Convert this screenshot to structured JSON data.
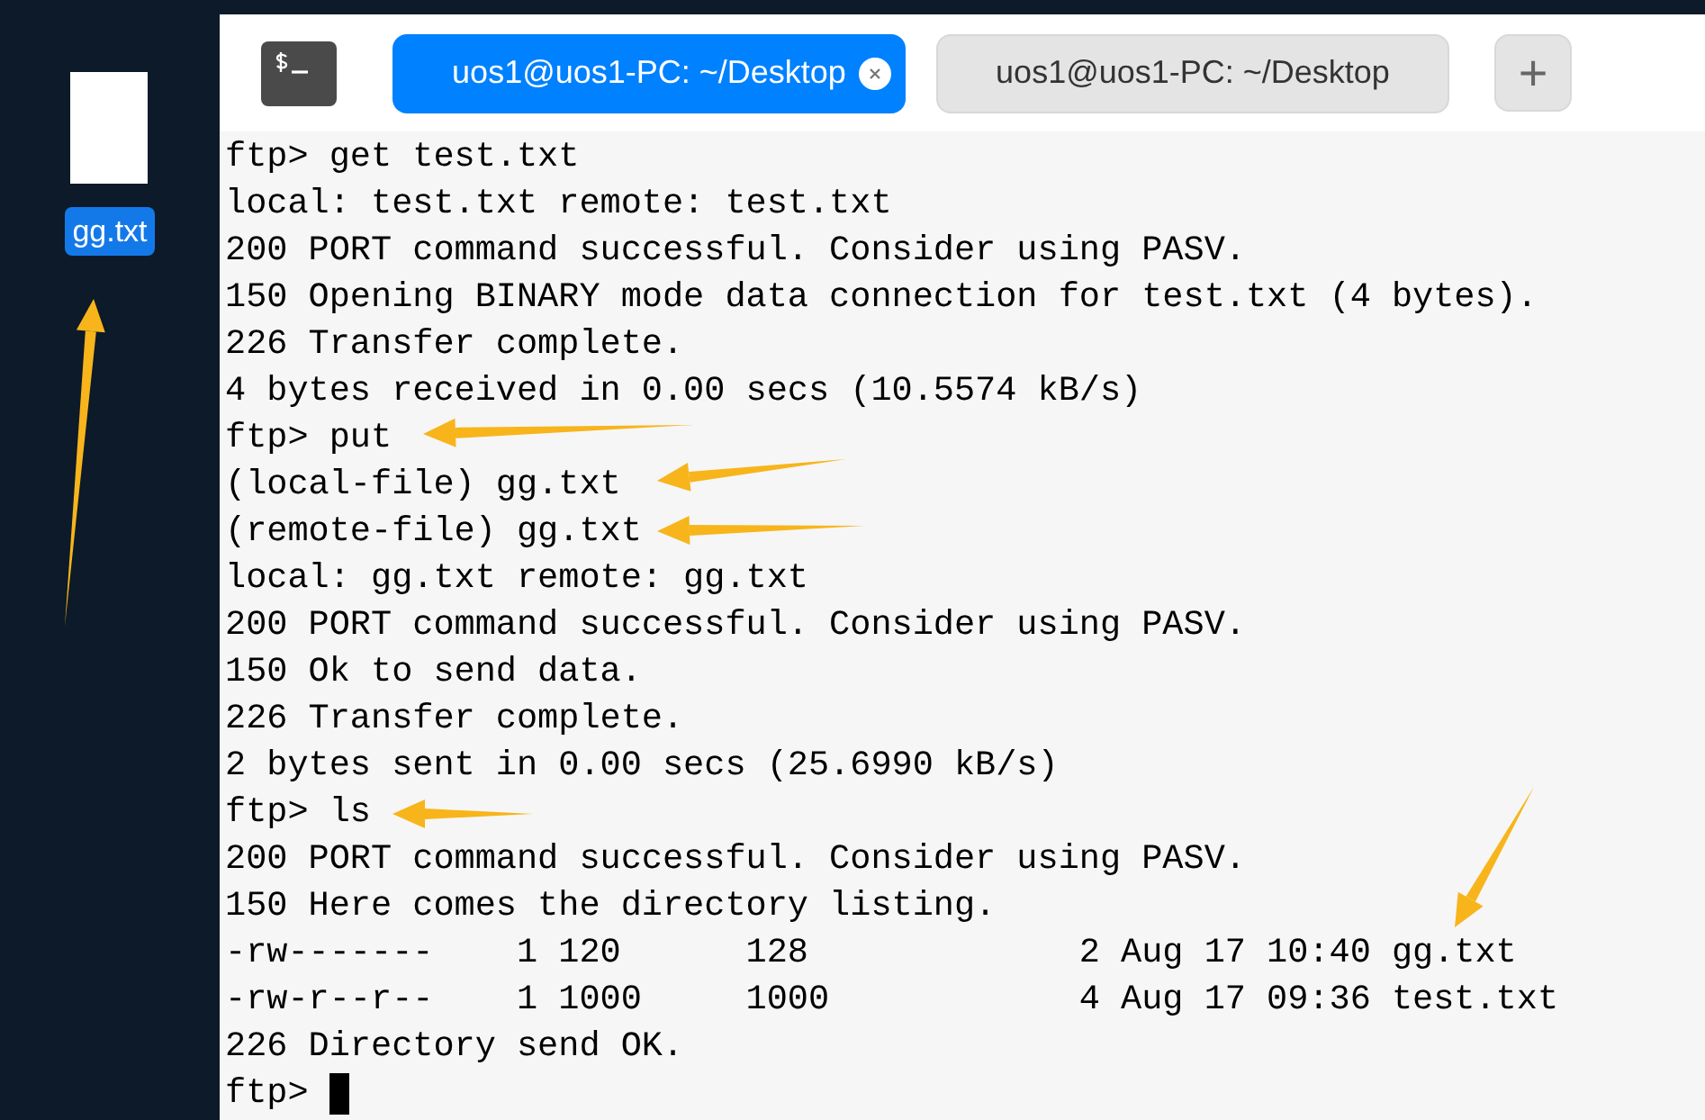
{
  "desktop": {
    "file": {
      "label": "gg.txt",
      "selected": true
    }
  },
  "terminal": {
    "tabs": [
      {
        "label": "uos1@uos1-PC: ~/Desktop",
        "selected": true
      },
      {
        "label": "uos1@uos1-PC: ~/Desktop",
        "selected": false
      }
    ],
    "new_tab": "+",
    "lines": [
      {
        "text": "ftp> get test.txt"
      },
      {
        "text": "local: test.txt remote: test.txt"
      },
      {
        "text": "200 PORT command successful. Consider using PASV."
      },
      {
        "text": "150 Opening BINARY mode data connection for test.txt (4 bytes)."
      },
      {
        "text": "226 Transfer complete."
      },
      {
        "text": "4 bytes received in 0.00 secs (10.5574 kB/s)"
      },
      {
        "text": "ftp> put"
      },
      {
        "text": "(local-file) gg.txt"
      },
      {
        "text": "(remote-file) gg.txt"
      },
      {
        "text": "local: gg.txt remote: gg.txt"
      },
      {
        "text": "200 PORT command successful. Consider using PASV."
      },
      {
        "text": "150 Ok to send data."
      },
      {
        "text": "226 Transfer complete."
      },
      {
        "text": "2 bytes sent in 0.00 secs (25.6990 kB/s)"
      },
      {
        "text": "ftp> ls"
      },
      {
        "text": "200 PORT command successful. Consider using PASV."
      },
      {
        "text": "150 Here comes the directory listing."
      },
      {
        "text": "-rw-------    1 120      128             2 Aug 17 10:40 gg.txt"
      },
      {
        "text": "-rw-r--r--    1 1000     1000            4 Aug 17 09:36 test.txt"
      },
      {
        "text": "226 Directory send OK."
      },
      {
        "text": "ftp>",
        "kind": "prompt"
      }
    ]
  }
}
